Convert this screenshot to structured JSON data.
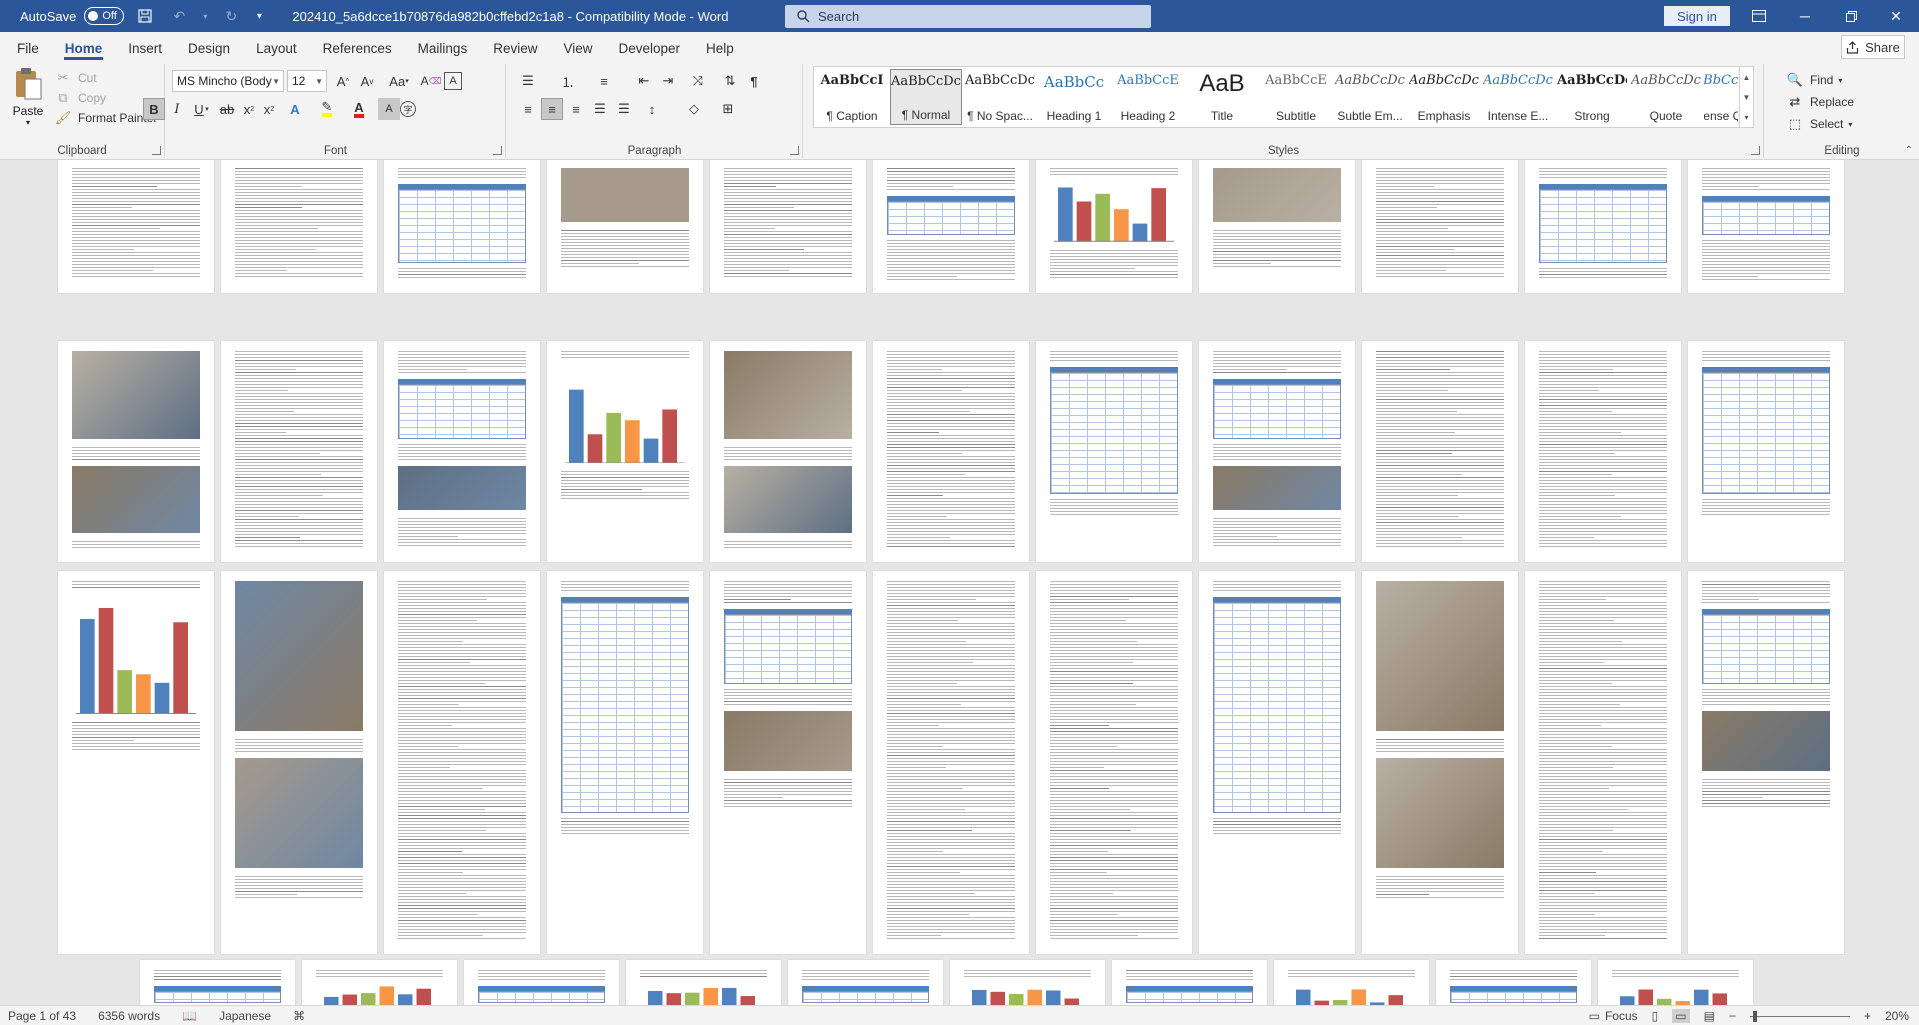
{
  "titlebar": {
    "autosave_label": "AutoSave",
    "autosave_state": "Off",
    "doc_title": "202410_5a6dcce1b70876da982b0cffebd2c1a8  -  Compatibility Mode  -  Word",
    "search_placeholder": "Search",
    "signin_label": "Sign in"
  },
  "tabs": [
    "File",
    "Home",
    "Insert",
    "Design",
    "Layout",
    "References",
    "Mailings",
    "Review",
    "View",
    "Developer",
    "Help"
  ],
  "active_tab": "Home",
  "share_label": "Share",
  "ribbon": {
    "clipboard": {
      "label": "Clipboard",
      "paste": "Paste",
      "cut": "Cut",
      "copy": "Copy",
      "format_painter": "Format Painter"
    },
    "font": {
      "label": "Font",
      "font_name": "MS Mincho (Body",
      "font_size": "12"
    },
    "paragraph": {
      "label": "Paragraph"
    },
    "styles": {
      "label": "Styles",
      "items": [
        {
          "sample": "AaBbCcI",
          "name": "¶ Caption"
        },
        {
          "sample": "AaBbCcDc",
          "name": "¶ Normal"
        },
        {
          "sample": "AaBbCcDc",
          "name": "¶ No Spac..."
        },
        {
          "sample": "AaBbCc",
          "name": "Heading 1"
        },
        {
          "sample": "AaBbCcE",
          "name": "Heading 2"
        },
        {
          "sample": "AaB",
          "name": "Title"
        },
        {
          "sample": "AaBbCcE",
          "name": "Subtitle"
        },
        {
          "sample": "AaBbCcDc",
          "name": "Subtle Em..."
        },
        {
          "sample": "AaBbCcDc",
          "name": "Emphasis"
        },
        {
          "sample": "AaBbCcDc",
          "name": "Intense E..."
        },
        {
          "sample": "AaBbCcDc",
          "name": "Strong"
        },
        {
          "sample": "AaBbCcDc",
          "name": "Quote"
        },
        {
          "sample": "AaBbCcDc",
          "name": "Intense Q..."
        }
      ],
      "selected_index": 1
    },
    "editing": {
      "label": "Editing",
      "find": "Find",
      "replace": "Replace",
      "select": "Select"
    }
  },
  "statusbar": {
    "page": "Page 1 of 43",
    "words": "6356 words",
    "language": "Japanese",
    "focus": "Focus",
    "zoom": "20%"
  },
  "colors": {
    "brand": "#2b579a",
    "table_head": "#4f81bd"
  }
}
